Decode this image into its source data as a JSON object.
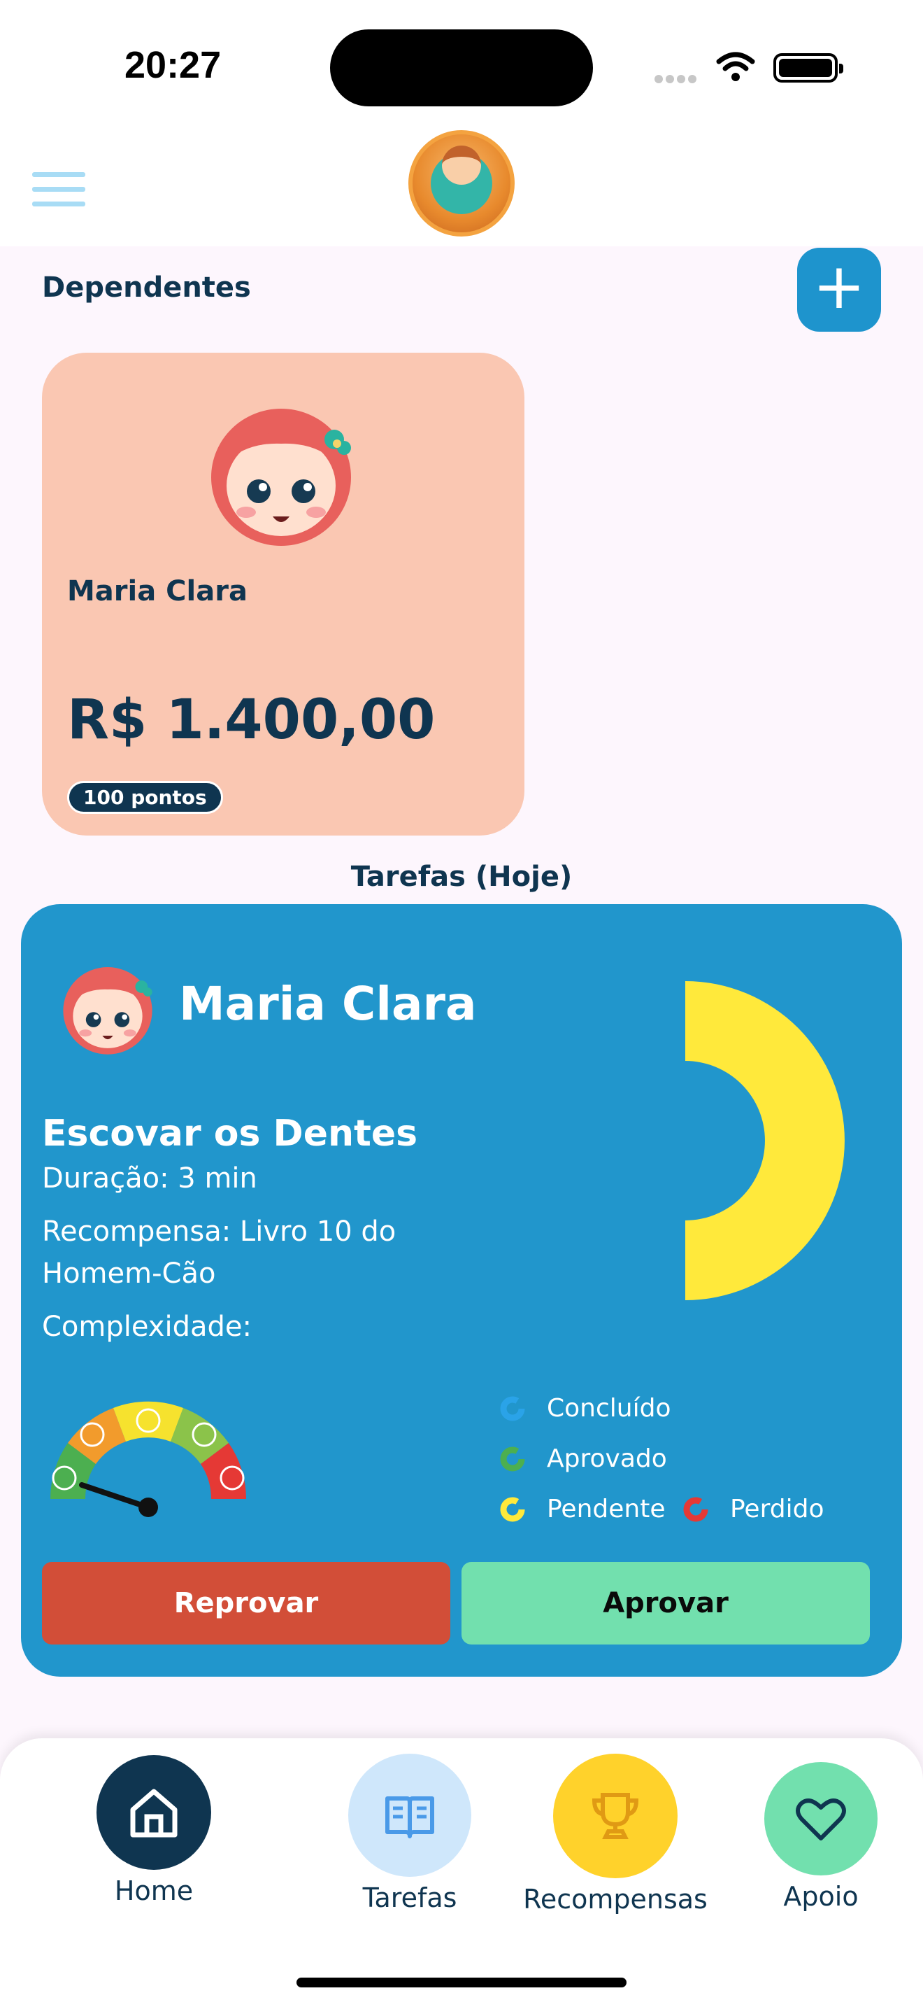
{
  "status_bar": {
    "time": "20:27"
  },
  "header": {
    "menu_icon": "hamburger-icon",
    "logo_icon": "app-logo-child"
  },
  "dependents": {
    "title": "Dependentes",
    "add_icon": "plus-icon",
    "cards": [
      {
        "name": "Maria Clara",
        "balance": "R$ 1.400,00",
        "points": "100 pontos",
        "avatar": "girl-avatar"
      }
    ]
  },
  "tasks": {
    "title": "Tarefas (Hoje)",
    "card": {
      "child_name": "Maria Clara",
      "task_name": "Escovar os Dentes",
      "duration": "Duração: 3 min",
      "reward": "Recompensa: Livro 10 do Homem-Cão",
      "complexity_label": "Complexidade:",
      "complexity_level": 0.1,
      "progress_chart": {
        "type": "donut",
        "segments": [
          {
            "label": "Pendente",
            "value": 1,
            "color": "#ffe93b"
          }
        ]
      },
      "legend": [
        {
          "label": "Concluído",
          "color": "#2aa3e8"
        },
        {
          "label": "Aprovado",
          "color": "#4caf50"
        },
        {
          "label": "Pendente",
          "color": "#ffe93b"
        },
        {
          "label": "Perdido",
          "color": "#e53935"
        }
      ],
      "reject_label": "Reprovar",
      "approve_label": "Aprovar"
    }
  },
  "bottom_nav": {
    "items": [
      {
        "label": "Home",
        "icon": "home-icon",
        "active": true
      },
      {
        "label": "Tarefas",
        "icon": "book-icon"
      },
      {
        "label": "Recompensas",
        "icon": "trophy-icon"
      },
      {
        "label": "Apoio",
        "icon": "heart-icon"
      }
    ]
  },
  "colors": {
    "primary": "#1e94cd",
    "dark": "#0f3550",
    "reject": "#d24e38",
    "approve": "#72e0ae",
    "card_bg": "#fac7b2"
  }
}
